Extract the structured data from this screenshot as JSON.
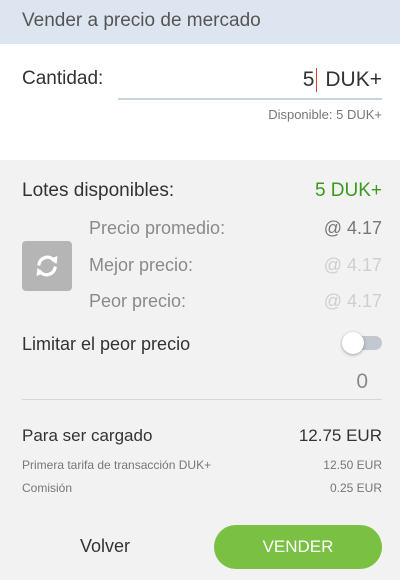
{
  "header": {
    "title": "Vender a precio de mercado"
  },
  "quantity": {
    "label": "Cantidad:",
    "value": "5",
    "unit": "DUK+",
    "available": "Disponible: 5 DUK+"
  },
  "lots": {
    "label": "Lotes disponibles:",
    "value": "5 DUK+"
  },
  "refresh": {
    "icon": "refresh-icon"
  },
  "prices": [
    {
      "label": "Precio promedio:",
      "value": "@ 4.17"
    },
    {
      "label": "Mejor precio:",
      "value": "@ 4.17"
    },
    {
      "label": "Peor precio:",
      "value": "@ 4.17"
    }
  ],
  "limit": {
    "label": "Limitar el peor precio",
    "enabled": false,
    "value": "0"
  },
  "charges": {
    "total_label": "Para ser cargado",
    "total_value": "12.75 EUR",
    "fee1_label": "Primera tarifa de transacción DUK+",
    "fee1_value": "12.50 EUR",
    "fee2_label": "Comisión",
    "fee2_value": "0.25 EUR"
  },
  "actions": {
    "back": "Volver",
    "sell": "VENDER"
  },
  "colors": {
    "accent_green": "#7ac143",
    "positive_text": "#3a9a1e",
    "header_bg": "#dde6f0",
    "caret": "#e53935"
  }
}
